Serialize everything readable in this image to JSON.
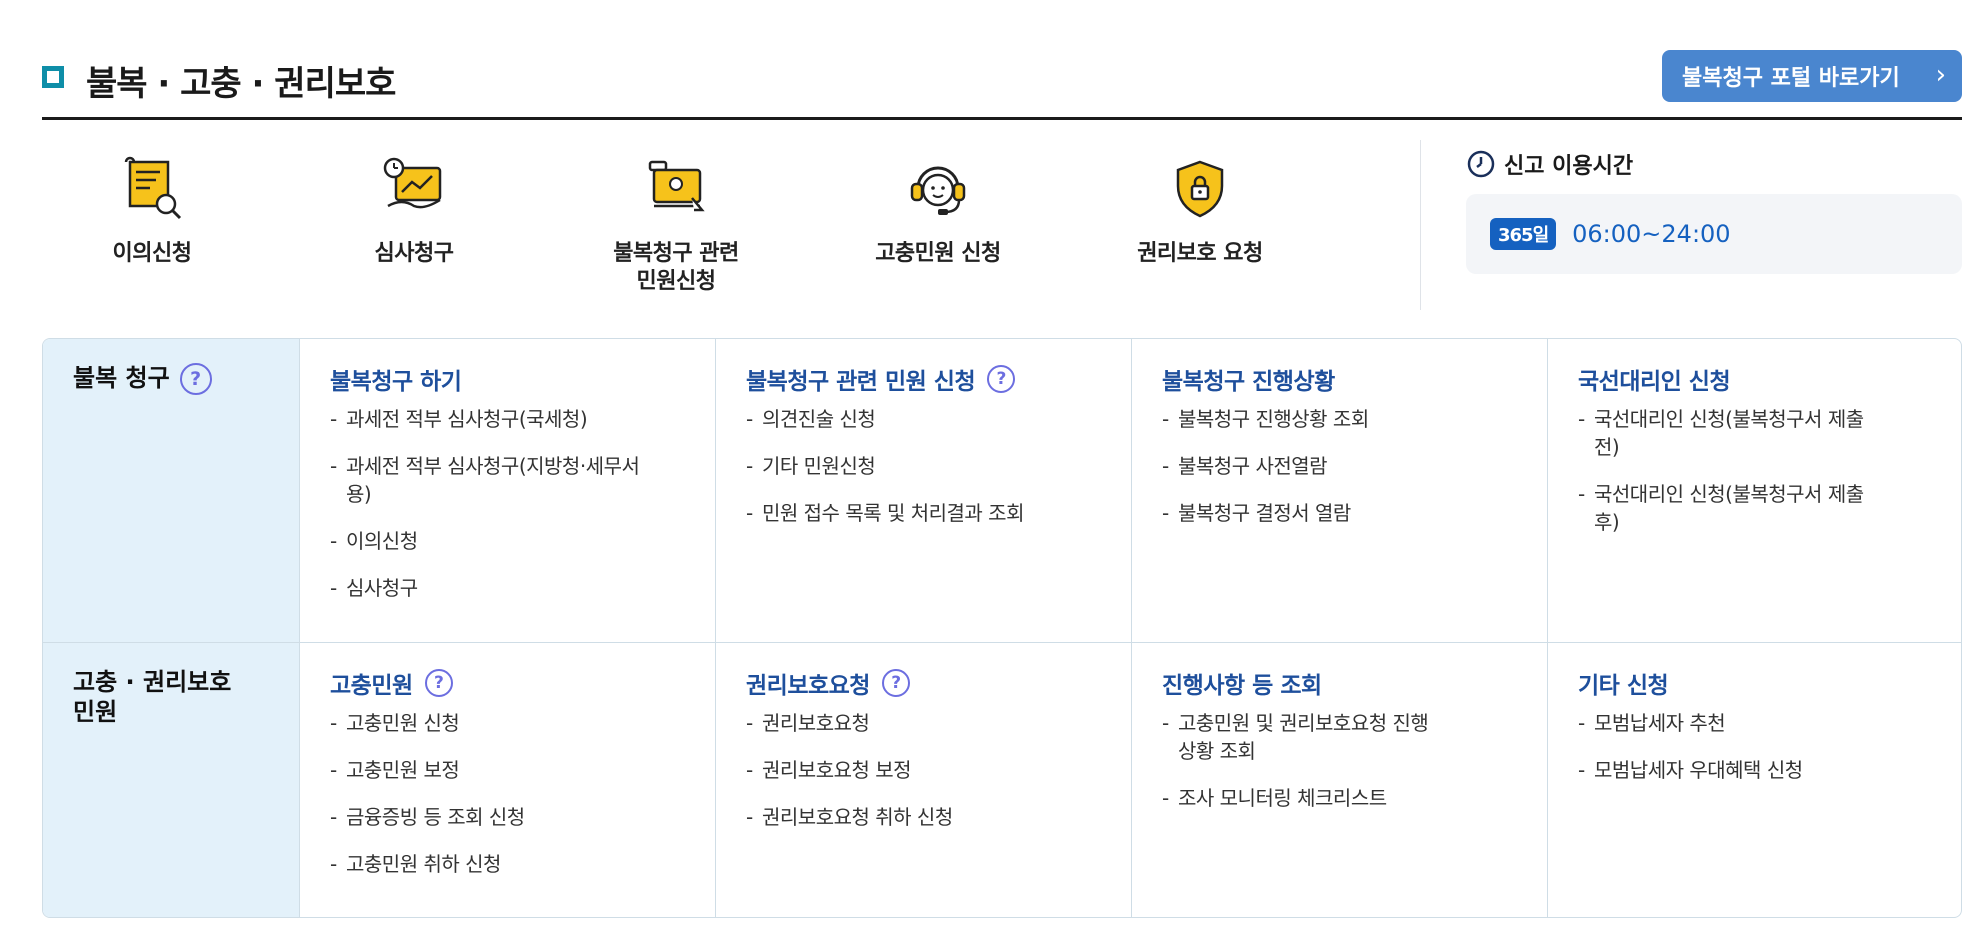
{
  "header": {
    "title": "불복 · 고충 · 권리보호",
    "portal_button": "불복청구 포털 바로가기"
  },
  "quick_menu": [
    {
      "label": "이의신청",
      "icon": "document-search-icon"
    },
    {
      "label": "심사청구",
      "icon": "hand-chart-clock-icon"
    },
    {
      "label": "불복청구 관련\n민원신청",
      "icon": "monitor-hand-icon"
    },
    {
      "label": "고충민원 신청",
      "icon": "headset-agent-icon"
    },
    {
      "label": "권리보호 요청",
      "icon": "shield-lock-icon"
    }
  ],
  "hours": {
    "title": "신고 이용시간",
    "badge": "365일",
    "time": "06:00~24:00"
  },
  "sections": [
    {
      "heading": "불복 청구",
      "has_help": true,
      "columns": [
        {
          "title": "불복청구 하기",
          "has_help": false,
          "items": [
            "과세전 적부 심사청구(국세청)",
            "과세전 적부 심사청구(지방청·세무서용)",
            "이의신청",
            "심사청구"
          ]
        },
        {
          "title": "불복청구 관련 민원 신청",
          "has_help": true,
          "items": [
            "의견진술 신청",
            "기타 민원신청",
            "민원 접수 목록 및 처리결과 조회"
          ]
        },
        {
          "title": "불복청구 진행상황",
          "has_help": false,
          "items": [
            "불복청구 진행상황 조회",
            "불복청구 사전열람",
            "불복청구 결정서 열람"
          ]
        },
        {
          "title": "국선대리인 신청",
          "has_help": false,
          "items": [
            "국선대리인 신청(불복청구서 제출전)",
            "국선대리인 신청(불복청구서 제출후)"
          ]
        }
      ]
    },
    {
      "heading": "고충 · 권리보호\n민원",
      "has_help": false,
      "columns": [
        {
          "title": "고충민원",
          "has_help": true,
          "items": [
            "고충민원 신청",
            "고충민원 보정",
            "금융증빙 등 조회 신청",
            "고충민원 취하 신청"
          ]
        },
        {
          "title": "권리보호요청",
          "has_help": true,
          "items": [
            "권리보호요청",
            "권리보호요청 보정",
            "권리보호요청 취하 신청"
          ]
        },
        {
          "title": "진행사항 등 조회",
          "has_help": false,
          "items": [
            "고충민원 및 권리보호요청 진행상황 조회",
            "조사 모니터링 체크리스트"
          ]
        },
        {
          "title": "기타 신청",
          "has_help": false,
          "items": [
            "모범납세자 추천",
            "모범납세자 우대혜택 신청"
          ]
        }
      ]
    }
  ],
  "colors": {
    "accent": "#1e4f9c",
    "button": "#4a86cf",
    "badge": "#1561c0",
    "rowhead_bg": "#e3f1fa",
    "help": "#6c6ee0"
  }
}
